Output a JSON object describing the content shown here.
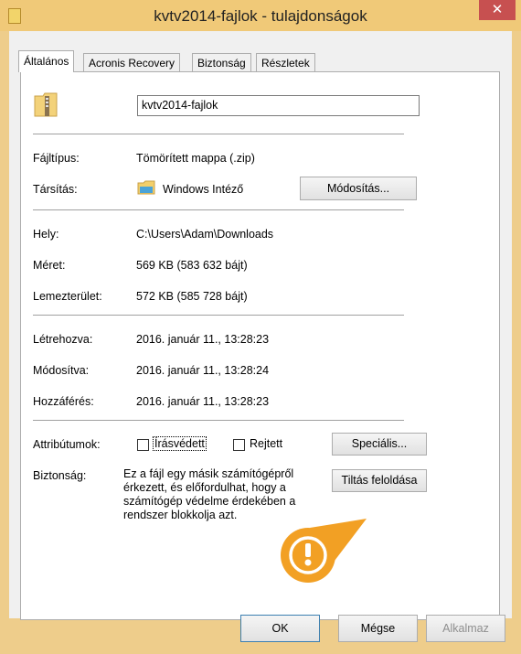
{
  "window": {
    "title": "kvtv2014-fajlok - tulajdonságok",
    "close_glyph": "✕"
  },
  "tabs": [
    {
      "label": "Általános"
    },
    {
      "label": "Acronis Recovery"
    },
    {
      "label": "Biztonság"
    },
    {
      "label": "Részletek"
    }
  ],
  "general": {
    "name_value": "kvtv2014-fajlok",
    "file_type_label": "Fájltípus:",
    "file_type_value": "Tömörített mappa (.zip)",
    "opens_with_label": "Társítás:",
    "opens_with_value": "Windows Intéző",
    "change_button": "Módosítás...",
    "location_label": "Hely:",
    "location_value": "C:\\Users\\Adam\\Downloads",
    "size_label": "Méret:",
    "size_value": "569 KB (583 632 bájt)",
    "size_on_disk_label": "Lemezterület:",
    "size_on_disk_value": "572 KB (585 728 bájt)",
    "created_label": "Létrehozva:",
    "created_value": "2016. január 11., 13:28:23",
    "modified_label": "Módosítva:",
    "modified_value": "2016. január 11., 13:28:24",
    "accessed_label": "Hozzáférés:",
    "accessed_value": "2016. január 11., 13:28:23",
    "attributes_label": "Attribútumok:",
    "readonly_label": "Írásvédett",
    "hidden_label": "Rejtett",
    "advanced_button": "Speciális...",
    "security_label": "Biztonság:",
    "security_text": "Ez a fájl egy másik számítógépről érkezett, és előfordulhat, hogy a számítógép védelme érdekében a rendszer blokkolja azt.",
    "unblock_button": "Tiltás feloldása"
  },
  "footer": {
    "ok_button": "OK",
    "cancel_button": "Mégse",
    "apply_button": "Alkalmaz"
  },
  "colors": {
    "accent_orange": "#f2a024",
    "title_bar": "#f0c978",
    "close_red": "#c75050"
  },
  "icons": {
    "app": "zip-folder-icon",
    "file": "zip-folder-icon",
    "opens_with": "explorer-folder-icon",
    "callout": "exclamation-icon"
  }
}
